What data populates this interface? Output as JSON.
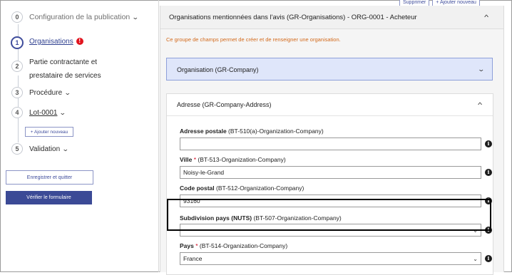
{
  "sidebar": {
    "steps": [
      {
        "number": "0",
        "label": "Configuration de la publication"
      },
      {
        "number": "1",
        "label": "Organisations",
        "error_badge": "!"
      },
      {
        "number": "2",
        "label_line1": "Partie contractante et",
        "label_line2": "prestataire de services"
      },
      {
        "number": "3",
        "label": "Procédure"
      },
      {
        "number": "4",
        "label": "Lot-0001"
      },
      {
        "number": "5",
        "label": "Validation"
      }
    ],
    "add_new_label": "+ Ajouter nouveau",
    "save_quit_label": "Enregistrer et quitter",
    "verify_label": "Vérifier le formulaire"
  },
  "top_actions": {
    "delete_label": "Supprimer",
    "add_new_label": "+ Ajouter nouveau"
  },
  "panel": {
    "title": "Organisations mentionnées dans l'avis (GR-Organisations) - ORG-0001 - Acheteur",
    "note": "Ce groupe de champs permet de créer et de renseigner une organisation.",
    "group_company": {
      "title": "Organisation (GR-Company)"
    },
    "group_address": {
      "title": "Adresse (GR-Company-Address)",
      "fields": {
        "postal_address": {
          "label": "Adresse postale",
          "code": "(BT-510(a)-Organization-Company)",
          "value": ""
        },
        "city": {
          "label": "Ville",
          "required": "*",
          "code": "(BT-513-Organization-Company)",
          "value": "Noisy-le-Grand"
        },
        "postal_code": {
          "label": "Code postal",
          "code": "(BT-512-Organization-Company)",
          "value": "93160"
        },
        "nuts": {
          "label": "Subdivision pays (NUTS)",
          "code": "(BT-507-Organization-Company)",
          "value": ""
        },
        "country": {
          "label": "Pays",
          "required": "*",
          "code": "(BT-514-Organization-Company)",
          "value": "France"
        }
      }
    }
  },
  "icons": {
    "info": "i",
    "chevron_down": "⌄",
    "chevron_up": "^"
  },
  "colors": {
    "primary": "#3b4a96",
    "note": "#d36a1c",
    "error": "#e1141e",
    "group_highlight": "#dfe6fa"
  }
}
